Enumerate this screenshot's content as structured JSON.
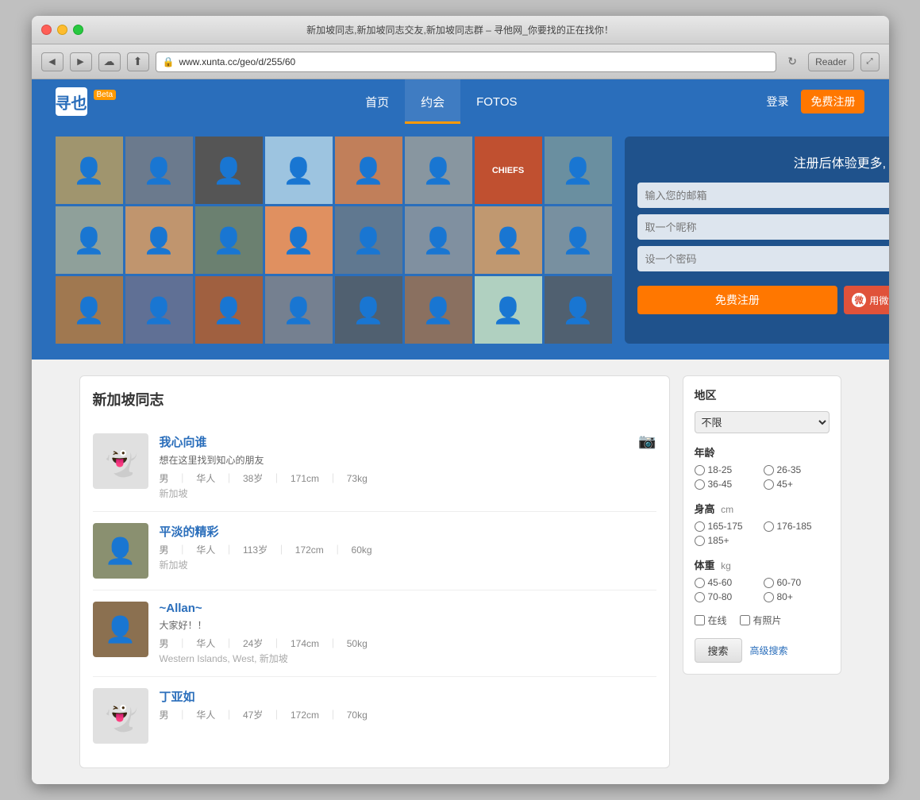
{
  "window": {
    "title": "新加坡同志,新加坡同志交友,新加坡同志群 – 寻他网_你要找的正在找你！"
  },
  "browser": {
    "url": "www.xunta.cc/geo/d/255/60",
    "reader_label": "Reader",
    "back_icon": "◀",
    "forward_icon": "▶",
    "refresh_icon": "↻",
    "fullscreen_icon": "⤢"
  },
  "header": {
    "logo_text": "寻也",
    "beta_label": "Beta",
    "nav_items": [
      {
        "label": "首页",
        "active": false
      },
      {
        "label": "约会",
        "active": true
      },
      {
        "label": "FOTOS",
        "active": false
      }
    ],
    "login_label": "登录",
    "register_label": "免费注册"
  },
  "hero": {
    "register_title": "注册后体验更多, 完全免费！",
    "email_placeholder": "输入您的邮箱",
    "nickname_placeholder": "取一个昵称",
    "password_placeholder": "设一个密码",
    "free_register_btn": "免费注册",
    "weibo_btn": "用微博账号登录",
    "photo_grid": [
      {
        "id": 1,
        "class": "pg1"
      },
      {
        "id": 2,
        "class": "pg2"
      },
      {
        "id": 3,
        "class": "pg3"
      },
      {
        "id": 4,
        "class": "pg4"
      },
      {
        "id": 5,
        "class": "pg5"
      },
      {
        "id": 6,
        "class": "pg6"
      },
      {
        "id": 7,
        "class": "pg7"
      },
      {
        "id": 8,
        "class": "pg8"
      },
      {
        "id": 9,
        "class": "pg9"
      },
      {
        "id": 10,
        "class": "pg10"
      },
      {
        "id": 11,
        "class": "pg11"
      },
      {
        "id": 12,
        "class": "pg12"
      },
      {
        "id": 13,
        "class": "pg13"
      },
      {
        "id": 14,
        "class": "pg14"
      },
      {
        "id": 15,
        "class": "pg15"
      },
      {
        "id": 16,
        "class": "pg16"
      },
      {
        "id": 17,
        "class": "pg17"
      },
      {
        "id": 18,
        "class": "pg18"
      },
      {
        "id": 19,
        "class": "pg19"
      },
      {
        "id": 20,
        "class": "pg20"
      },
      {
        "id": 21,
        "class": "pg21"
      },
      {
        "id": 22,
        "class": "pg22"
      },
      {
        "id": 23,
        "class": "pg23"
      },
      {
        "id": 24,
        "class": "pg24"
      }
    ]
  },
  "user_list": {
    "section_title": "新加坡同志",
    "users": [
      {
        "id": 1,
        "name": "我心向谁",
        "bio": "想在这里找到知心的朋友",
        "gender": "男",
        "ethnicity": "华人",
        "age": "38岁",
        "height": "171cm",
        "weight": "73kg",
        "location": "新加坡",
        "has_photo": false,
        "has_camera": true
      },
      {
        "id": 2,
        "name": "平淡的精彩",
        "bio": null,
        "gender": "男",
        "ethnicity": "华人",
        "age": "113岁",
        "height": "172cm",
        "weight": "60kg",
        "location": "新加坡",
        "has_photo": true,
        "has_camera": false
      },
      {
        "id": 3,
        "name": "~Allan~",
        "bio": "大家好！！",
        "gender": "男",
        "ethnicity": "华人",
        "age": "24岁",
        "height": "174cm",
        "weight": "50kg",
        "location": "Western Islands, West, 新加坡",
        "has_photo": true,
        "has_camera": false
      },
      {
        "id": 4,
        "name": "丁亚如",
        "bio": null,
        "gender": "男",
        "ethnicity": "华人",
        "age": "47岁",
        "height": "172cm",
        "weight": "70kg",
        "location": "",
        "has_photo": false,
        "has_camera": false
      }
    ]
  },
  "filter": {
    "region_label": "地区",
    "region_default": "不限",
    "age_label": "年龄",
    "age_options": [
      {
        "label": "18-25",
        "value": "18-25"
      },
      {
        "label": "26-35",
        "value": "26-35"
      },
      {
        "label": "36-45",
        "value": "36-45"
      },
      {
        "label": "45+",
        "value": "45+"
      }
    ],
    "height_label": "身高",
    "height_unit": "cm",
    "height_options": [
      {
        "label": "165-175",
        "value": "165-175"
      },
      {
        "label": "176-185",
        "value": "176-185"
      },
      {
        "label": "185+",
        "value": "185+"
      }
    ],
    "weight_label": "体重",
    "weight_unit": "kg",
    "weight_options": [
      {
        "label": "45-60",
        "value": "45-60"
      },
      {
        "label": "60-70",
        "value": "60-70"
      },
      {
        "label": "70-80",
        "value": "70-80"
      },
      {
        "label": "80+",
        "value": "80+"
      }
    ],
    "online_label": "在线",
    "photo_label": "有照片",
    "search_btn": "搜索",
    "advanced_btn": "高级搜索"
  }
}
